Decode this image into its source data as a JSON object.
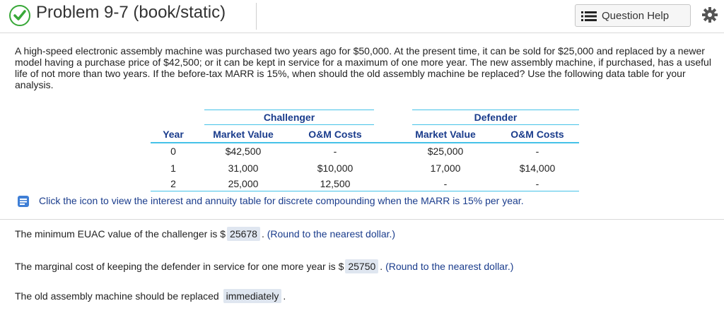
{
  "header": {
    "title": "Problem 9-7 (book/static)",
    "help_label": "Question Help",
    "status_color": "#38a838"
  },
  "problem_text": "A high-speed electronic assembly machine was purchased two years ago for $50,000. At the present time, it can be sold for $25,000 and replaced by a newer model having a purchase price of $42,500; or it can be kept in service for a maximum of one more year. The new assembly machine, if purchased, has a useful life of not more than two years. If the before-tax MARR is 15%, when should the old assembly machine be replaced? Use the following data table for your analysis.",
  "table": {
    "group_challenger": "Challenger",
    "group_defender": "Defender",
    "col_year": "Year",
    "col_ch_mv": "Market Value",
    "col_ch_om": "O&M Costs",
    "col_df_mv": "Market Value",
    "col_df_om": "O&M Costs",
    "rows": [
      {
        "year": "0",
        "ch_mv": "$42,500",
        "ch_om": "-",
        "df_mv": "$25,000",
        "df_om": "-"
      },
      {
        "year": "1",
        "ch_mv": "31,000",
        "ch_om": "$10,000",
        "df_mv": "17,000",
        "df_om": "$14,000"
      },
      {
        "year": "2",
        "ch_mv": "25,000",
        "ch_om": "12,500",
        "df_mv": "-",
        "df_om": "-"
      }
    ]
  },
  "info_text": "Click the icon to view the interest and annuity table for discrete compounding when the MARR is 15% per year.",
  "answers": {
    "q1_prefix": "The minimum EUAC value of the challenger is $",
    "q1_value": "25678",
    "q1_hint": "(Round to the nearest dollar.)",
    "q2_prefix": "The marginal cost of keeping the defender in service for one more year is $",
    "q2_value": "25750",
    "q2_hint": "(Round to the nearest dollar.)",
    "q3_prefix": "The old assembly machine should be replaced",
    "q3_value": "immediately",
    "period": "."
  }
}
